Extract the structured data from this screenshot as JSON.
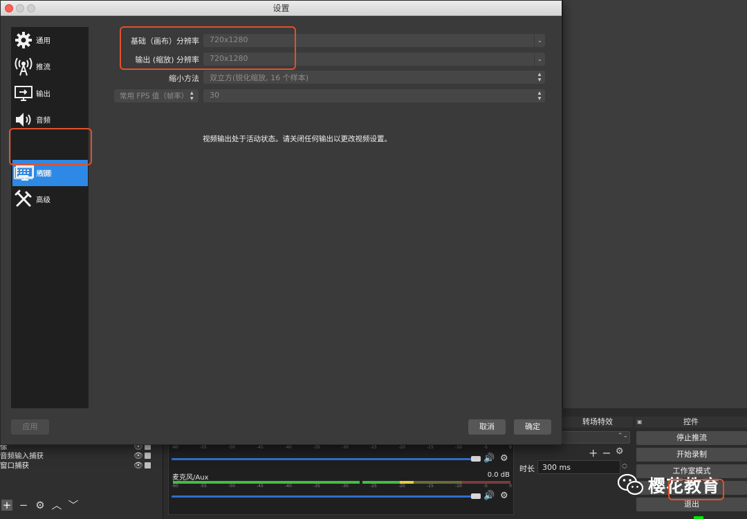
{
  "dialog": {
    "title": "设置",
    "nav": [
      {
        "label": "通用",
        "icon": "gear-icon"
      },
      {
        "label": "推流",
        "icon": "broadcast-antenna-icon"
      },
      {
        "label": "输出",
        "icon": "output-monitor-icon"
      },
      {
        "label": "音频",
        "icon": "speaker-icon"
      },
      {
        "label": "视频",
        "icon": "display-monitor-icon"
      },
      {
        "label": "热键",
        "icon": "keyboard-icon"
      },
      {
        "label": "高级",
        "icon": "tools-icon"
      }
    ],
    "active_nav": "视频",
    "video": {
      "base_resolution_label": "基础（画布）分辨率",
      "base_resolution_value": "720x1280",
      "output_resolution_label": "输出 (缩放) 分辨率",
      "output_resolution_value": "720x1280",
      "downscale_label": "缩小方法",
      "downscale_value": "双立方(锐化缩放, 16 个样本)",
      "fps_type": "常用 FPS 值（帧率）",
      "fps_value": "30",
      "notice": "视频输出处于活动状态。请关闭任何输出以更改视频设置。"
    },
    "buttons": {
      "apply": "应用",
      "cancel": "取消",
      "ok": "确定"
    }
  },
  "obs": {
    "sources": [
      "像",
      "音频输入捕获",
      "窗口捕获"
    ],
    "mixer": {
      "scale": [
        "-60",
        "-55",
        "-50",
        "-45",
        "-40",
        "-35",
        "-30",
        "-25",
        "-20",
        "-15",
        "-10",
        "-5",
        "0"
      ],
      "track2_name": "麦克风/Aux",
      "track2_db": "0.0 dB"
    },
    "transitions": {
      "header": "转场特效",
      "duration_label": "时长",
      "duration_value": "300 ms"
    },
    "controls": {
      "header": "控件",
      "stop_stream": "停止推流",
      "start_record": "开始录制",
      "studio_mode": "工作室模式",
      "settings": "",
      "exit": "退出"
    }
  },
  "watermark": {
    "text": "樱花教育"
  },
  "colors": {
    "accent": "#2d89e5",
    "annotation": "#e4502a",
    "meter_green": "#3fbf3f"
  }
}
